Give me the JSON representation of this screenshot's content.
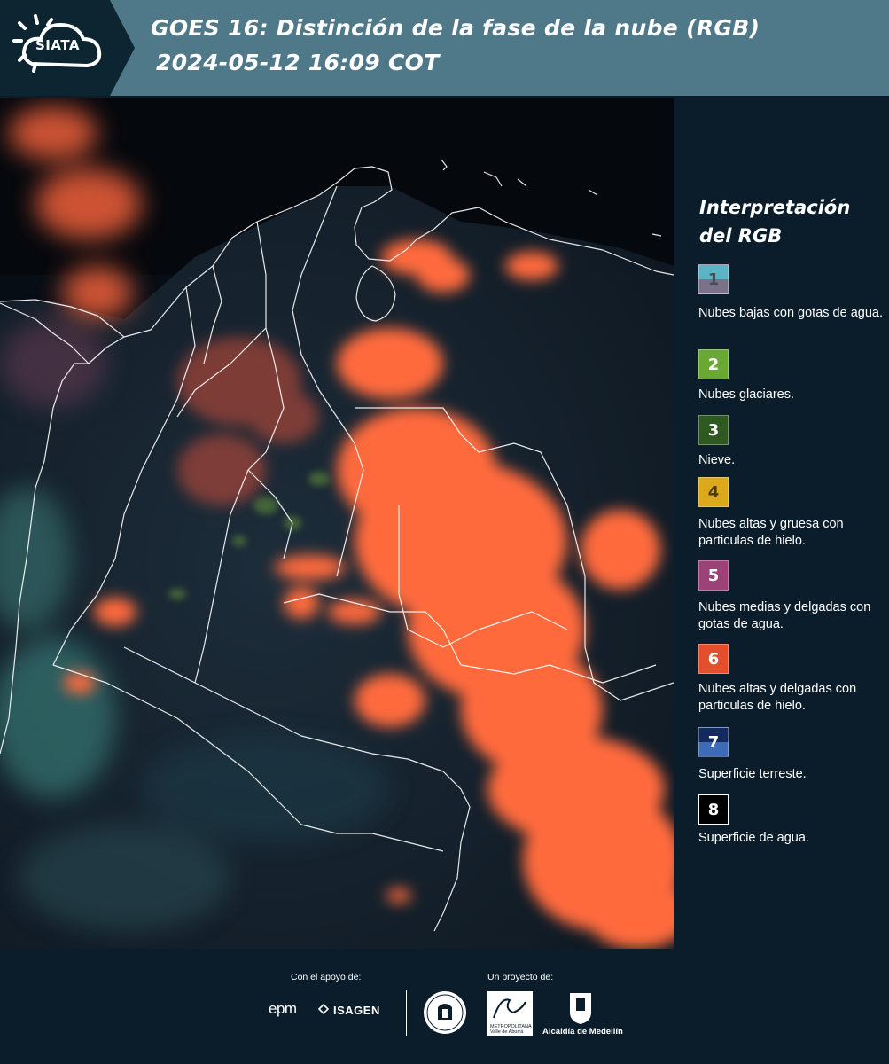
{
  "header": {
    "logo_text": "SIATA",
    "title_line1": "GOES 16: Distinción de la fase de la nube (RGB)",
    "title_line2": "2024-05-12 16:09 COT"
  },
  "legend": {
    "title": "Interpretación del RGB",
    "items": [
      {
        "number": "1",
        "label": "Nubes bajas con gotas de agua.",
        "color_top": "#5bb3c4",
        "color_bottom": "#7a7289"
      },
      {
        "number": "2",
        "label": "Nubes glaciares.",
        "color_top": "#6aa834",
        "color_bottom": "#6aa834"
      },
      {
        "number": "3",
        "label": "Nieve.",
        "color_top": "#2f5a1f",
        "color_bottom": "#2f5a1f"
      },
      {
        "number": "4",
        "label": "Nubes altas y gruesa con particulas de hielo.",
        "color_top": "#dca81c",
        "color_bottom": "#dca81c"
      },
      {
        "number": "5",
        "label": "Nubes medias y delgadas con gotas de agua.",
        "color_top": "#9c4278",
        "color_bottom": "#9c4278"
      },
      {
        "number": "6",
        "label": "Nubes altas y delgadas con particulas de hielo.",
        "color_top": "#e34f2c",
        "color_bottom": "#e34f2c"
      },
      {
        "number": "7",
        "label": "Superficie terreste.",
        "color_top": "#142a5e",
        "color_bottom": "#3d6bb8"
      },
      {
        "number": "8",
        "label": "Superficie de agua.",
        "color_top": "#000000",
        "color_bottom": "#000000"
      }
    ]
  },
  "footer": {
    "support_label": "Con el apoyo de:",
    "project_label": "Un proyecto de:",
    "epm_logo": "epm",
    "isagen_logo": "ISAGEN",
    "area_logo_line1": "METROPOLITANA",
    "area_logo_line2": "Valle de Aburrá",
    "medellin_logo": "Alcaldía de Medellín"
  },
  "colors": {
    "header_bg": "#4f7889",
    "header_dark": "#0d2431",
    "page_bg": "#0b1d2b",
    "cloud_orange": "#ff6a3d"
  }
}
